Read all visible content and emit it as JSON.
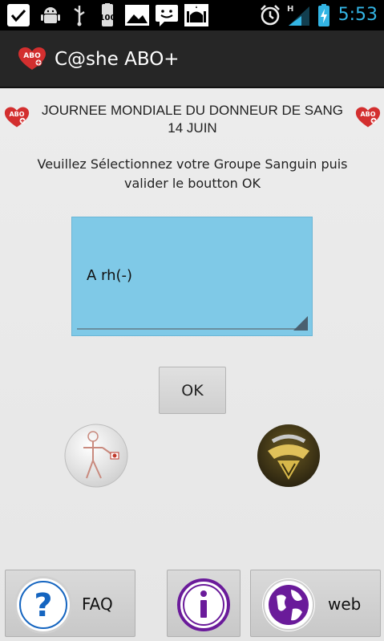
{
  "status_bar": {
    "time": "5:53",
    "battery_level_label": "100",
    "network_type": "H",
    "icons": [
      "check-icon",
      "android-debug-icon",
      "usb-icon",
      "battery-100-icon",
      "gallery-icon",
      "chat-icon",
      "mosque-icon",
      "alarm-icon",
      "signal-icon",
      "battery-charging-icon"
    ]
  },
  "action_bar": {
    "app_title": "C@she ABO+",
    "logo_text": "ABO"
  },
  "content": {
    "headline": "JOURNEE MONDIALE DU DONNEUR DE SANG 14 JUIN",
    "instruction": "Veuillez Sélectionnez votre Groupe Sanguin puis valider le boutton OK",
    "blood_group_selected": "A rh(-)",
    "ok_label": "OK"
  },
  "bottom_bar": {
    "faq_label": "FAQ",
    "info_label": "",
    "web_label": "web"
  },
  "colors": {
    "spinner_bg": "#7fc9e7",
    "status_time": "#33b5e5",
    "accent_purple": "#6a1b9a",
    "heart_red": "#d32f2f"
  }
}
